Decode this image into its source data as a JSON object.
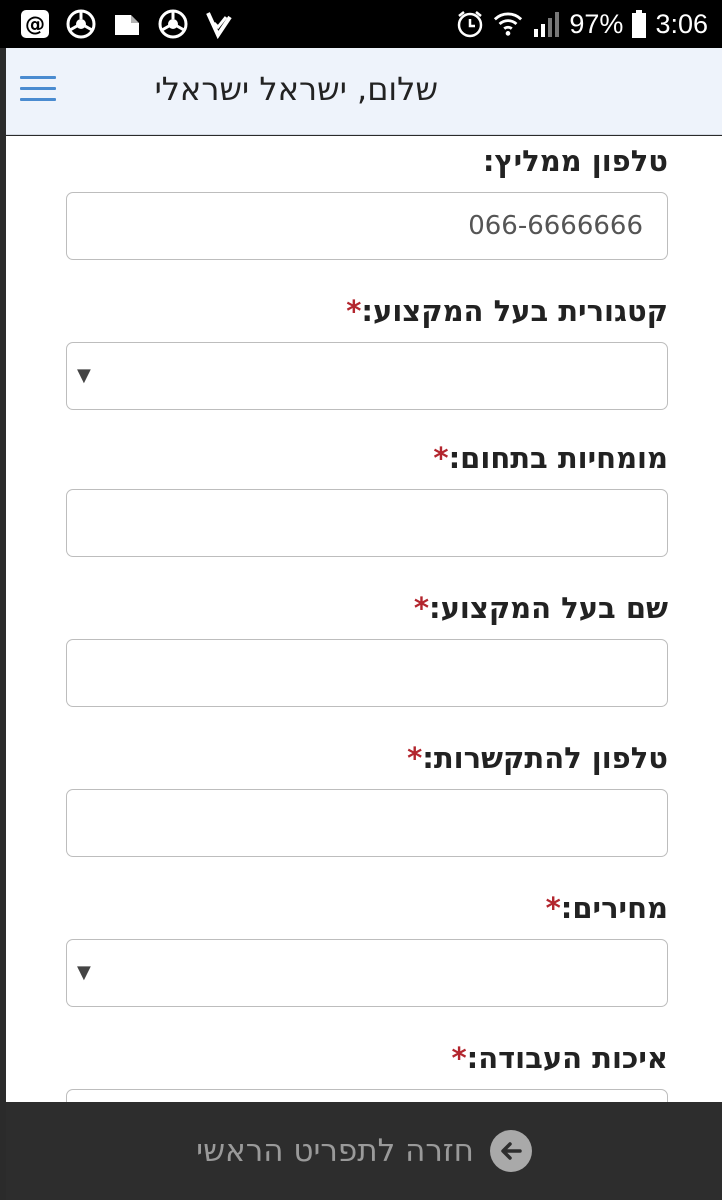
{
  "status_bar": {
    "battery": "97%",
    "time": "3:06",
    "icons": [
      "at-sign-icon",
      "chrome-icon",
      "cloud-upload-icon",
      "chrome-icon",
      "check-tag-icon",
      "alarm-icon",
      "wifi-icon",
      "signal-icon",
      "battery-icon"
    ]
  },
  "header": {
    "greeting": "שלום, ישראל ישראלי",
    "menu_icon": "hamburger-menu-icon",
    "accent_color": "#4a8bd0"
  },
  "form": {
    "recommender_phone": {
      "label": "טלפון ממליץ:",
      "value": "066-6666666"
    },
    "category": {
      "label": "קטגורית בעל המקצוע:",
      "required_mark": "*",
      "value": ""
    },
    "expertise": {
      "label": "מומחיות בתחום:",
      "required_mark": "*",
      "value": ""
    },
    "pro_name": {
      "label": "שם בעל המקצוע:",
      "required_mark": "*",
      "value": ""
    },
    "contact_phone": {
      "label": "טלפון להתקשרות:",
      "required_mark": "*",
      "value": ""
    },
    "prices": {
      "label": "מחירים:",
      "required_mark": "*",
      "value": ""
    },
    "work_quality": {
      "label": "איכות העבודה:",
      "required_mark": "*",
      "value": ""
    }
  },
  "bottom_bar": {
    "back_label": "חזרה לתפריט הראשי",
    "back_icon": "arrow-left-circle-icon"
  },
  "colors": {
    "required": "#b3262e",
    "header_bg": "#eef3fb",
    "bottom_bar_bg": "#2d2d2d"
  }
}
